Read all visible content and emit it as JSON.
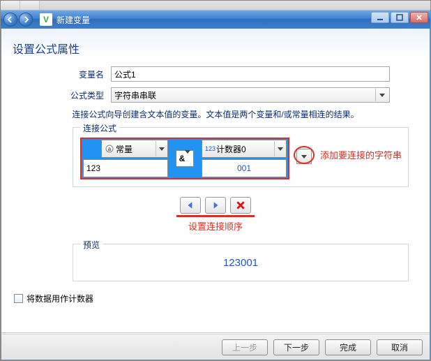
{
  "window": {
    "app_icon_letter": "V",
    "title": "新建变量"
  },
  "page": {
    "header": "设置公式属性",
    "var_name_label": "变量名",
    "var_name_value": "公式1",
    "formula_type_label": "公式类型",
    "formula_type_value": "字符串串联",
    "info_line": "连接公式向导创建含文本值的变量。文本值是两个变量和/或常量相连的结果。"
  },
  "concat": {
    "legend": "连接公式",
    "left_type": "常量",
    "left_value": "123",
    "operator": "&",
    "right_type": "计数器0",
    "right_value": "001"
  },
  "annotations": {
    "add_string": "添加要连接的字符串",
    "set_order": "设置连接顺序"
  },
  "preview": {
    "legend": "预览",
    "value": "123001"
  },
  "checkbox": {
    "label": "将数据用作计数器"
  },
  "footer": {
    "prev": "上一步",
    "next": "下一步",
    "finish": "完成",
    "cancel": "取消"
  }
}
